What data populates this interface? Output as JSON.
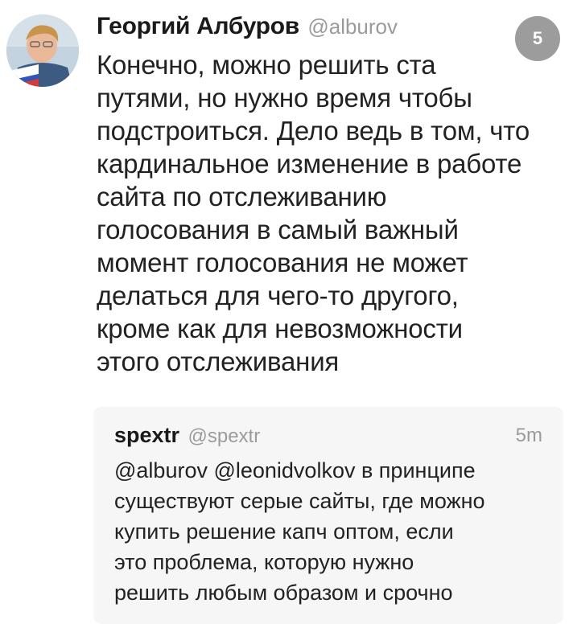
{
  "tweet": {
    "author_name": "Георгий Албуров",
    "author_handle": "@alburov",
    "badge_count": "5",
    "lines": [
      "Конечно, можно решить ста",
      "путями, но нужно время чтобы",
      "подстроиться. Дело ведь в том, что",
      "кардинальное изменение в работе",
      "сайта по отслеживанию",
      "голосования в самый важный",
      "момент голосования не может",
      "делаться для чего-то другого,",
      "кроме как для невозможности",
      "этого отслеживания"
    ]
  },
  "reply": {
    "author_name": "spextr",
    "author_handle": "@spextr",
    "time": "5m",
    "lines": [
      "@alburov @leonidvolkov в принципе",
      "существуют серые сайты, где можно",
      "купить решение капч оптом, если",
      "это проблема, которую нужно",
      "решить любым образом и срочно"
    ]
  },
  "colors": {
    "background": "#ffffff",
    "reply_background": "#f6f6f6",
    "handle_gray": "#9b9b9b",
    "badge_gray": "#9c9c9c"
  },
  "icons": {
    "avatar": "user-avatar-photo"
  }
}
